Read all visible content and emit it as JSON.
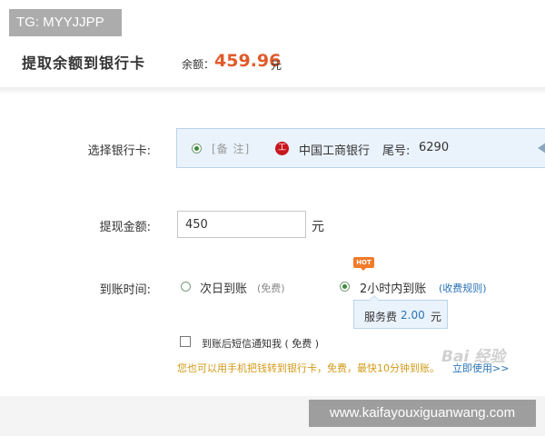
{
  "watermark_tag": "TG: MYYJJPP",
  "header": {
    "title": "提取余额到银行卡",
    "balance_label": "余额：",
    "balance_amount": "459.96",
    "balance_unit": "元"
  },
  "bank_card": {
    "label": "选择银行卡:",
    "remark": "[备 注]",
    "bank_logo_glyph": "工",
    "bank_name": "中国工商银行",
    "tail_label": "尾号:",
    "tail_number": "6290",
    "selected": true
  },
  "amount": {
    "label": "提现金额:",
    "value": "450",
    "unit": "元"
  },
  "arrival": {
    "label": "到账时间:",
    "options": [
      {
        "text": "次日到账",
        "note": "(免费)",
        "selected": false
      },
      {
        "text": "2小时内到账",
        "note": "",
        "badge": "HOT",
        "selected": true,
        "link": "(收费规则)"
      }
    ],
    "fee_label": "服务费",
    "fee_value": "2.00",
    "fee_unit": "元"
  },
  "sms_notify": {
    "text": "到账后短信通知我 ( 免费 )",
    "checked": false
  },
  "tip": {
    "text": "您也可以用手机把钱转到银行卡，免费，最快10分钟到账。",
    "link": "立即使用>>"
  },
  "baidu_watermark": "Bai 经验",
  "site_watermark": "www.kaifayouxiguanwang.com",
  "colors": {
    "balance_orange": "#e15a2c",
    "link_blue": "#2a73b6",
    "tip_gold": "#d29a1a",
    "hot_orange": "#f07b2a",
    "card_bg": "#eaf3fb"
  }
}
